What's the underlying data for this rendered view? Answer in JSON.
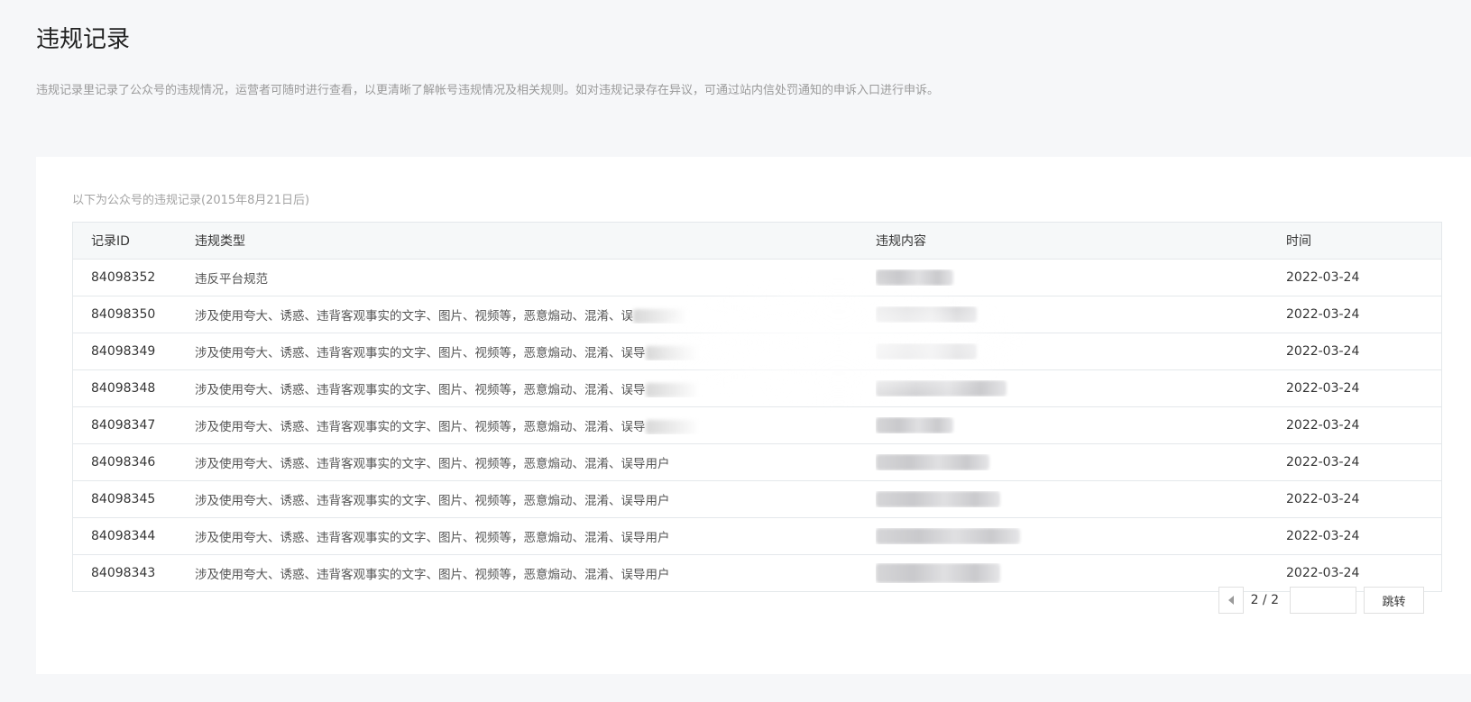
{
  "page": {
    "title": "违规记录",
    "description": "违规记录里记录了公众号的违规情况，运营者可随时进行查看，以更清晰了解帐号违规情况及相关规则。如对违规记录存在异议，可通过站内信处罚通知的申诉入口进行申诉。"
  },
  "card": {
    "subtitle": "以下为公众号的违规记录(2015年8月21日后)"
  },
  "table": {
    "headers": {
      "id": "记录ID",
      "type": "违规类型",
      "content": "违规内容",
      "time": "时间"
    },
    "rows": [
      {
        "id": "84098352",
        "type": "违反平台规范",
        "time": "2022-03-24"
      },
      {
        "id": "84098350",
        "type": "涉及使用夸大、诱惑、违背客观事实的文字、图片、视频等，恶意煽动、混淆、误",
        "time": "2022-03-24"
      },
      {
        "id": "84098349",
        "type": "涉及使用夸大、诱惑、违背客观事实的文字、图片、视频等，恶意煽动、混淆、误导",
        "time": "2022-03-24"
      },
      {
        "id": "84098348",
        "type": "涉及使用夸大、诱惑、违背客观事实的文字、图片、视频等，恶意煽动、混淆、误导",
        "time": "2022-03-24"
      },
      {
        "id": "84098347",
        "type": "涉及使用夸大、诱惑、违背客观事实的文字、图片、视频等，恶意煽动、混淆、误导",
        "time": "2022-03-24"
      },
      {
        "id": "84098346",
        "type": "涉及使用夸大、诱惑、违背客观事实的文字、图片、视频等，恶意煽动、混淆、误导用户",
        "time": "2022-03-24"
      },
      {
        "id": "84098345",
        "type": "涉及使用夸大、诱惑、违背客观事实的文字、图片、视频等，恶意煽动、混淆、误导用户",
        "time": "2022-03-24"
      },
      {
        "id": "84098344",
        "type": "涉及使用夸大、诱惑、违背客观事实的文字、图片、视频等，恶意煽动、混淆、误导用户",
        "time": "2022-03-24"
      },
      {
        "id": "84098343",
        "type": "涉及使用夸大、诱惑、违背客观事实的文字、图片、视频等，恶意煽动、混淆、误导用户",
        "time": "2022-03-24"
      }
    ]
  },
  "pager": {
    "page_indicator": "2 / 2",
    "jump_label": "跳转",
    "input_value": "",
    "prev_icon": "triangle-left-icon"
  },
  "colors": {
    "background": "#f6f7f9",
    "card": "#ffffff",
    "border": "#e4e8eb",
    "header_bg": "#f6f8f9",
    "muted_text": "#9a9a9a"
  }
}
